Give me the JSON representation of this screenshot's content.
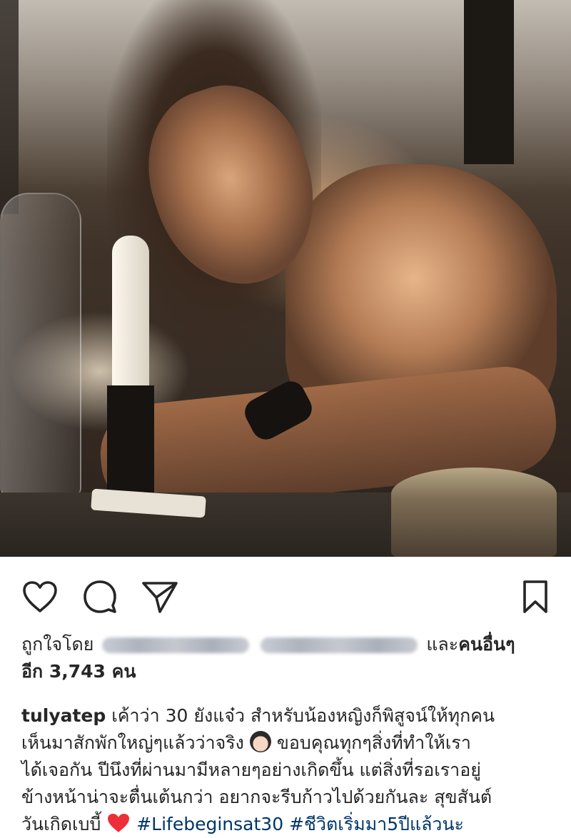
{
  "post": {
    "image": {
      "icon": "photo-woman-writing-by-candle"
    },
    "actions": {
      "like_icon": "heart-outline-icon",
      "comment_icon": "comment-bubble-icon",
      "share_icon": "paper-plane-icon",
      "save_icon": "bookmark-icon"
    },
    "likes": {
      "prefix": "ถูกใจโดย",
      "and_text": "และ",
      "others_text": "คนอื่นๆ",
      "count_line": "อีก 3,743 คน"
    },
    "caption": {
      "username": "tulyatep",
      "text_1": "เค้าว่า 30 ยังแจ๋ว สำหรับน้องหญิงก็พิสูจน์ให้ทุกคน",
      "text_2": "เห็นมาสักพักใหญ่ๆแล้วว่าจริง",
      "emoji_1": "woman-face-emoji",
      "text_3": "ขอบคุณทุกๆสิ่งที่ทำให้เรา",
      "text_4": "ได้เจอกัน ปีนึงที่ผ่านมามีหลายๆอย่างเกิดขึ้น แต่สิ่งที่รอเราอยู่",
      "text_5": "ข้างหน้าน่าจะตื่นเต้นกว่า อยากจะรีบก้าวไปด้วยกันละ สุขสันต์",
      "text_6": "วันเกิดเบบี้",
      "emoji_2": "red-heart-emoji",
      "hashtag_1": "#Lifebeginsat30",
      "hashtag_2": "#ชีวิตเริ่มมา5ปีแล้วนะ"
    },
    "colors": {
      "text": "#262626",
      "hashtag": "#003569",
      "heart": "#ED2F3A"
    }
  }
}
